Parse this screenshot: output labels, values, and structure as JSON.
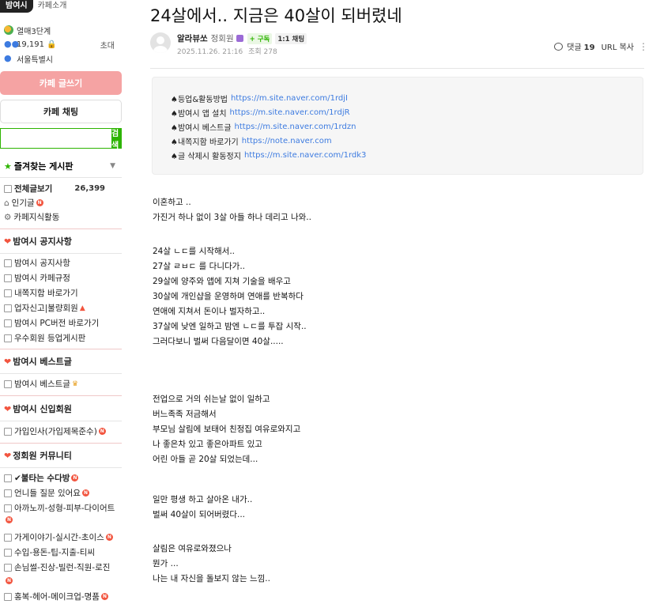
{
  "sidebar": {
    "logo": "밤여시",
    "cafe_intro": "카페소개",
    "level": "열매3단계",
    "members": "19,191",
    "invite": "초대",
    "location": "서울특별시",
    "write_button": "카페 글쓰기",
    "chat_button": "카페 채팅",
    "search_placeholder": "",
    "search_button": "검색",
    "favorites_label": "즐겨찾는 게시판",
    "all_posts": {
      "label": "전체글보기",
      "count": "26,399"
    },
    "popular": "인기글",
    "knowledge": "카페지식활동",
    "sections": [
      {
        "title": "밤여시 공지사항",
        "items": [
          "밤여시 공지사항",
          "밤여시 카페규정",
          "내쪽지함 바로가기",
          "업자신고|불량회원",
          "밤여시 PC버전 바로가기",
          "우수회원 등업게시판"
        ]
      },
      {
        "title": "밤여시 베스트글",
        "items": [
          "밤여시 베스트글"
        ]
      },
      {
        "title": "밤여시 신입회원",
        "items": [
          "가입인사(가입제목준수)"
        ]
      },
      {
        "title": "정회원 커뮤니티",
        "items": [
          "✔불타는 수다방",
          "언니들 질문 있어요",
          "아까노끼-성형-피부-다이어트",
          "가게이야기-실시간-초이스",
          "수입-용돈-팁-지출-티씨",
          "손님썰-진상-빌런-직원-로진",
          "홍복-헤어-메이크업-명품"
        ]
      }
    ]
  },
  "post": {
    "title": "24살에서.. 지금은 40살이 되버렸네",
    "author": "알라뷰쏘",
    "grade": "정회원",
    "follow": "+ 구독",
    "chat": "1:1 채팅",
    "date": "2025.11.26. 21:16",
    "views": "조회 278",
    "comment_label": "댓글",
    "comment_count": "19",
    "url_copy": "URL 복사",
    "notice": [
      {
        "label": "♠등업&활동방법",
        "url": "https://m.site.naver.com/1rdjI"
      },
      {
        "label": "♠밤여시 앱 설치",
        "url": "https://m.site.naver.com/1rdjR"
      },
      {
        "label": "♠밤여시 베스트글",
        "url": "https://m.site.naver.com/1rdzn"
      },
      {
        "label": "♠내쪽지함 바로가기",
        "url": "https://note.naver.com"
      },
      {
        "label": "♠글 삭제시 활동정지",
        "url": "https://m.site.naver.com/1rdk3"
      }
    ],
    "paragraphs": [
      [
        "이혼하고 ..",
        "가진거 하나 없이 3살 아들 하나 데리고 나와.."
      ],
      [
        "24살 ㄴㄷ를 시작해서..",
        "27살 ㄹㅂㄷ 를 다니다가..",
        "29살에 양주와 앱에 지쳐 기술을 배우고",
        "30살에 개인샵을 운영하며 연애를 반복하다",
        "연애에 지쳐서 돈이나 벌자하고..",
        "37살에 낮엔 일하고 밤엔 ㄴㄷ를 투잡 시작..",
        "그러다보니 벌써 다음달이면 40살....."
      ],
      [
        "전업으로 거의 쉬는날 없이 일하고",
        "버느족족 저금해서",
        "부모님 살림에 보태어 친정집 여유로와지고",
        "나 좋은차 있고 좋은아파트 있고",
        "어린 아들 곧 20살 되었는데..."
      ],
      [
        "일만 평생 하고 살아온 내가..",
        "벌써 40살이 되어버렸다..."
      ],
      [
        "살림은 여유로와졌으나",
        "뭔가 ...",
        "나는 내 자신을 돌보지 않는 느낌.."
      ]
    ]
  }
}
